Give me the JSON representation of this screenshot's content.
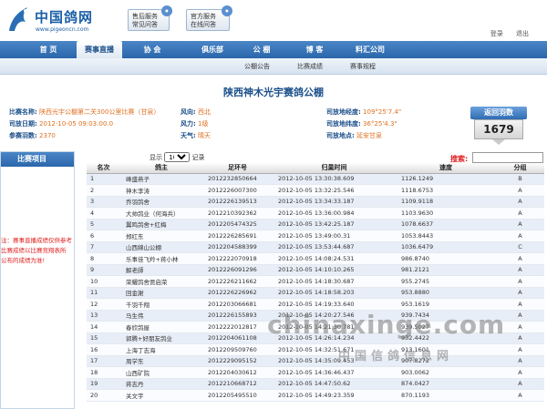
{
  "site": {
    "title": "中国鸽网",
    "url": "www.pigeoncn.com",
    "service1": [
      "售后服务",
      "常见问答"
    ],
    "service2": [
      "官方服务",
      "在线问答"
    ],
    "links": [
      "登录",
      "退出"
    ]
  },
  "nav": [
    "首 页",
    "赛事直播",
    "协 会",
    "俱乐部",
    "公 棚",
    "博 客",
    "料汇公司"
  ],
  "subnav": [
    "公棚公告",
    "比赛成绩",
    "赛事规程"
  ],
  "page_title": "陕西神木光宇赛鸽公棚",
  "info": {
    "race_name_label": "比赛名称:",
    "race_name": "陕西光宇公棚第二关300公里比赛（甘泉）",
    "wind_dir_label": "风向:",
    "wind_dir": "西北",
    "release_lng_label": "司放地经度:",
    "release_lng": "109°25'7.4\"",
    "date_label": "司放日期:",
    "date": "2012-10-05 09:03:00.0",
    "wind_power_label": "风力:",
    "wind_power": "1级",
    "release_lat_label": "司放地纬度:",
    "release_lat": "36°25'4.3\"",
    "count_label": "参赛羽数:",
    "count": "2370",
    "weather_label": "天气:",
    "weather": "晴天",
    "release_place_label": "司放地点:",
    "release_place": "延安甘泉"
  },
  "returned": {
    "label": "返回羽数",
    "value": "1679"
  },
  "sidebar": {
    "title": "比赛项目",
    "note": [
      "注：赛事直播成绩仅供参考",
      "比赛成绩以比赛竞翔表所",
      "公布的成绩为准!"
    ]
  },
  "controls": {
    "show_label": "显示",
    "per_page": "100",
    "records_label": "记录",
    "search_label": "搜索:"
  },
  "table": {
    "headers": [
      "名次",
      "鸽主",
      "足环号",
      "归巢时间",
      "速度",
      "分组"
    ],
    "rows": [
      [
        "1",
        "峰盛燕子",
        "2012232850664",
        "2012-10-05 13:30:38.609",
        "1126.1249",
        "B"
      ],
      [
        "2",
        "神木李涛",
        "2012226007300",
        "2012-10-05 13:32:25.546",
        "1118.6753",
        "A"
      ],
      [
        "3",
        "乔羽鸽舍",
        "2012226139513",
        "2012-10-05 13:34:33.187",
        "1109.9118",
        "A"
      ],
      [
        "4",
        "大帅鸽业（何海兵）",
        "2012210392362",
        "2012-10-05 13:36:00.984",
        "1103.9630",
        "A"
      ],
      [
        "5",
        "翼鸣鸽舍+红梅",
        "2012205474325",
        "2012-10-05 13:42:25.187",
        "1078.6637",
        "A"
      ],
      [
        "6",
        "郑红东",
        "2012226285691",
        "2012-10-05 13:49:00.31",
        "1053.8443",
        "A"
      ],
      [
        "7",
        "山西綿山公棚",
        "2012204588399",
        "2012-10-05 13:53:44.687",
        "1036.6479",
        "C"
      ],
      [
        "8",
        "乐事佳飞羚+蒋小林",
        "2012222070918",
        "2012-10-05 14:08:24.531",
        "986.8740",
        "A"
      ],
      [
        "9",
        "解老師",
        "2012226091296",
        "2012-10-05 14:10:10.265",
        "981.2121",
        "A"
      ],
      [
        "10",
        "荣耀鸽舍贾启荣",
        "2012226211662",
        "2012-10-05 14:18:30.687",
        "955.2745",
        "A"
      ],
      [
        "11",
        "回金謝",
        "2012226226962",
        "2012-10-05 14:18:58.203",
        "953.8880",
        "A"
      ],
      [
        "12",
        "千羽千翔",
        "2012203066681",
        "2012-10-05 14:19:33.640",
        "953.1619",
        "A"
      ],
      [
        "13",
        "马生伟",
        "2012226155893",
        "2012-10-05 14:20:27.546",
        "939.7434",
        "A"
      ],
      [
        "14",
        "春欣鸽屋",
        "2012222012817",
        "2012-10-05 14:21:30.781",
        "939.5027",
        "A"
      ],
      [
        "15",
        "郭腾+好朋友鸽业",
        "2012204061108",
        "2012-10-05 14:26:14.234",
        "932.4422",
        "A"
      ],
      [
        "16",
        "上海丁志海",
        "2012209509760",
        "2012-10-05 14:32:51.671",
        "913.1601",
        "A"
      ],
      [
        "17",
        "周学东",
        "2012229095152",
        "2012-10-05 14:35:09.453",
        "907.8272",
        "A"
      ],
      [
        "18",
        "山西矿院",
        "2012204030612",
        "2012-10-05 14:36:46.437",
        "903.0062",
        "A"
      ],
      [
        "19",
        "蒋志丹",
        "2012210668712",
        "2012-10-05 14:47:50.62",
        "874.0427",
        "A"
      ],
      [
        "20",
        "关文宇",
        "2012205495510",
        "2012-10-05 14:49:23.359",
        "870.1193",
        "A"
      ]
    ]
  },
  "watermark": {
    "main": "chinaxinge.com",
    "sub": "中国信鸽信息网"
  },
  "colors": {
    "nav": "#2a66ab",
    "accent": "#e07020",
    "title": "#1b4f8a"
  }
}
